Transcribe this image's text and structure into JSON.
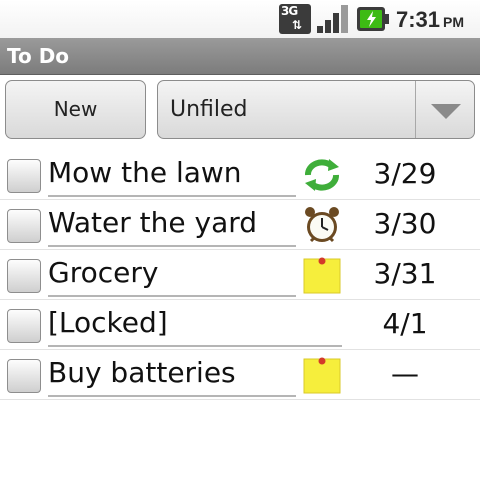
{
  "status_bar": {
    "network_label": "3G",
    "network_arrows": "⇅",
    "time": "7:31",
    "ampm": "PM",
    "battery_color": "#3dbb14"
  },
  "app": {
    "title": "To Do"
  },
  "toolbar": {
    "new_label": "New",
    "folder_value": "Unfiled"
  },
  "tasks": [
    {
      "description": "Mow the lawn",
      "checked": false,
      "icon": "recurring-icon",
      "due": "3/29"
    },
    {
      "description": "Water the yard",
      "checked": false,
      "icon": "alarm-clock-icon",
      "due": "3/30"
    },
    {
      "description": "Grocery",
      "checked": false,
      "icon": "note-icon",
      "due": "3/31"
    },
    {
      "description": "[Locked]",
      "checked": false,
      "icon": "",
      "due": "4/1"
    },
    {
      "description": "Buy batteries",
      "checked": false,
      "icon": "note-icon",
      "due": "—"
    }
  ]
}
